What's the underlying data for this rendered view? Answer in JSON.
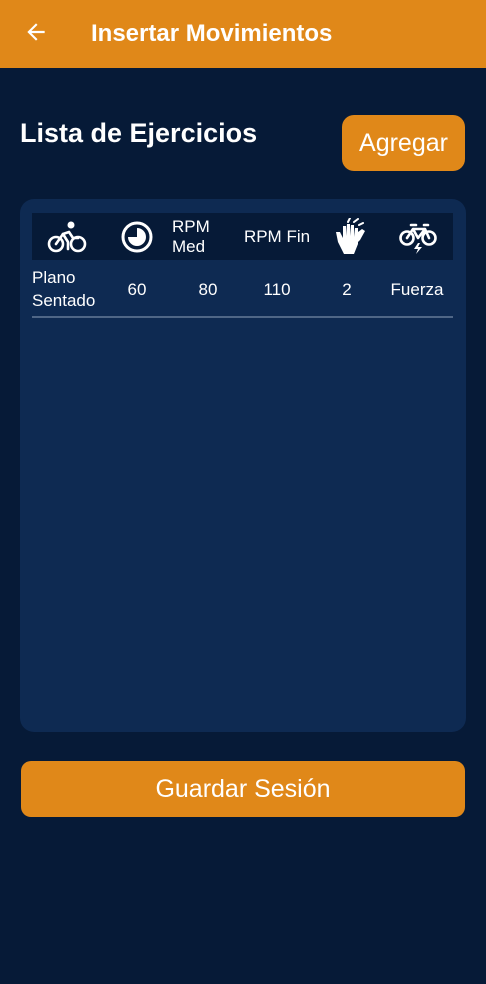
{
  "appbar": {
    "title": "Insertar Movimientos",
    "back_icon": "arrow-left-icon",
    "color": "#e08819"
  },
  "section": {
    "title": "Lista de Ejercicios",
    "add_label": "Agregar"
  },
  "table": {
    "headers": [
      {
        "icon": "bike-rider-icon",
        "label": ""
      },
      {
        "icon": "timer-icon",
        "label": ""
      },
      {
        "icon": "",
        "label": "RPM\nMed"
      },
      {
        "icon": "",
        "label": "RPM Fin"
      },
      {
        "icon": "hands-icon",
        "label": ""
      },
      {
        "icon": "bike-power-icon",
        "label": ""
      }
    ],
    "rows": [
      {
        "movement": "Plano\nSentado",
        "time": "60",
        "rpm_med": "80",
        "rpm_fin": "110",
        "hands": "2",
        "type": "Fuerza"
      }
    ]
  },
  "footer": {
    "save_label": "Guardar Sesión"
  },
  "colors": {
    "background": "#061a37",
    "panel": "#0e2a52",
    "accent": "#e08819"
  }
}
